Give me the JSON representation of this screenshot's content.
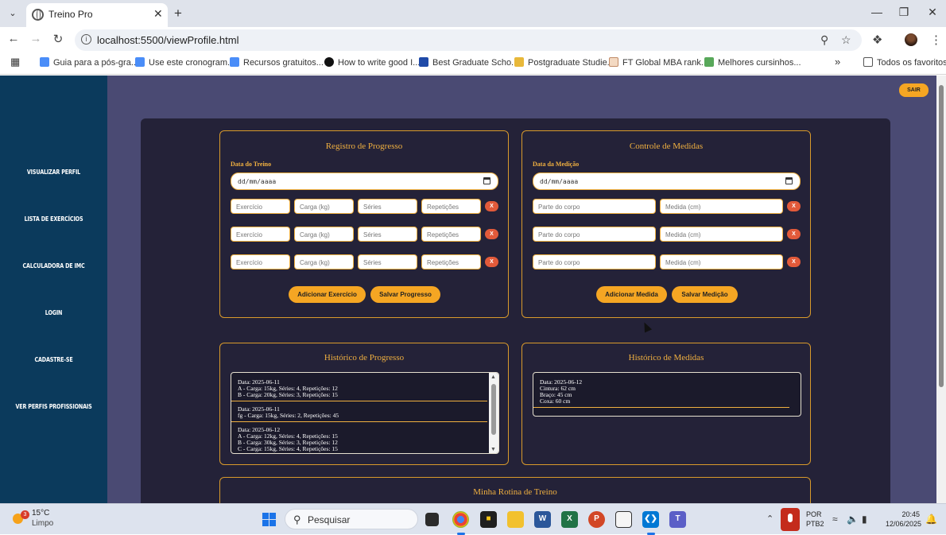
{
  "browser": {
    "tab_title": "Treino Pro",
    "url": "localhost:5500/viewProfile.html",
    "bookmarks": [
      "Guia para a pós-gra...",
      "Use este cronogram...",
      "Recursos gratuitos...",
      "How to write good I...",
      "Best Graduate Scho...",
      "Postgraduate Studie...",
      "FT Global MBA rank...",
      "Melhores cursinhos..."
    ],
    "bookmarks_more": "»",
    "all_bookmarks": "Todos os favoritos"
  },
  "sidebar": {
    "items": [
      "Visualizar Perfil",
      "Lista de Exercícios",
      "Calculadora de IMC",
      "Login",
      "Cadastre-se",
      "Ver Perfis Profissionais"
    ]
  },
  "header": {
    "logout": "SAIR"
  },
  "progress_form": {
    "title": "Registro de Progresso",
    "date_label": "Data do Treino",
    "date_placeholder": "dd/mm/aaaa",
    "placeholders": {
      "exercise": "Exercício",
      "load": "Carga (kg)",
      "sets": "Séries",
      "reps": "Repetições"
    },
    "remove": "X",
    "add_button": "Adicionar Exercício",
    "save_button": "Salvar Progresso"
  },
  "measures_form": {
    "title": "Controle de Medidas",
    "date_label": "Data da Medição",
    "date_placeholder": "dd/mm/aaaa",
    "placeholders": {
      "part": "Parte do corpo",
      "measure": "Medida (cm)"
    },
    "remove": "X",
    "add_button": "Adicionar Medida",
    "save_button": "Salvar Medição"
  },
  "progress_history": {
    "title": "Histórico de Progresso",
    "entries": [
      [
        "Data: 2025-06-11",
        "A - Carga: 15kg, Séries: 4, Repetições: 12",
        "B - Carga: 20kg, Séries: 3, Repetições: 15"
      ],
      [
        "Data: 2025-06-11",
        "fg - Carga: 15kg, Séries: 2, Repetições: 45"
      ],
      [
        "Data: 2025-06-12",
        "A - Carga: 12kg, Séries: 4, Repetições: 15",
        "B - Carga: 30kg, Séries: 3, Repetições: 12",
        "C - Carga: 15kg, Séries: 4, Repetições: 15"
      ]
    ]
  },
  "measures_history": {
    "title": "Histórico de Medidas",
    "entries": [
      [
        "Data: 2025-06-12",
        "Cintura: 62 cm",
        "Braço: 45 cm",
        "Coxa: 60 cm"
      ]
    ]
  },
  "routine": {
    "title": "Minha Rotina de Treino"
  },
  "taskbar": {
    "weather_temp": "15°C",
    "weather_desc": "Limpo",
    "weather_badge": "3",
    "search": "Pesquisar",
    "lang_line1": "POR",
    "lang_line2": "PTB2",
    "time": "20:45",
    "date": "12/06/2025"
  }
}
